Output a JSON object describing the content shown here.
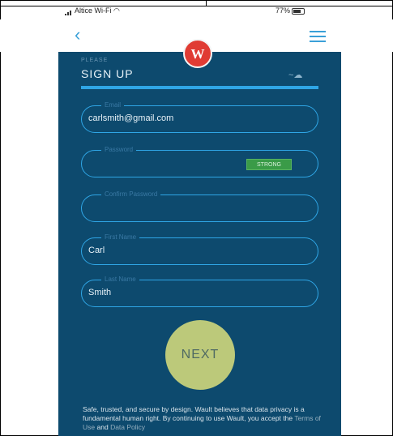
{
  "status_bar": {
    "carrier": "Altice Wi-Fi",
    "battery": "77%"
  },
  "navbar": {
    "back_icon": "chevron-left-icon",
    "menu_icon": "hamburger-menu-icon",
    "logo_letter": "W"
  },
  "signup": {
    "pre_title": "PLEASE",
    "title": "SIGN UP",
    "progress": 1.0,
    "fields": [
      {
        "label": "Email",
        "value": "carlsmith@gmail.com",
        "placeholder": ""
      },
      {
        "label": "Password",
        "value": "",
        "placeholder": "",
        "strength": "STRONG"
      },
      {
        "label": "Confirm Password",
        "value": "",
        "placeholder": ""
      },
      {
        "label": "First Name",
        "value": "Carl",
        "placeholder": ""
      },
      {
        "label": "Last Name",
        "value": "Smith",
        "placeholder": ""
      }
    ],
    "next_label": "NEXT",
    "footer": {
      "text_1": "Safe, trusted, and secure by design. Wault believes that data privacy is a fundamental human right. By continuing to use Wault, you accept the",
      "terms_link": "Terms of Use",
      "and": "and",
      "privacy_link": "Data Policy"
    }
  },
  "colors": {
    "panel": "#0d4a6e",
    "accent": "#2fa6e6",
    "next": "#bcc97a",
    "badge": "#3a9b48",
    "logo": "#e03b33"
  }
}
